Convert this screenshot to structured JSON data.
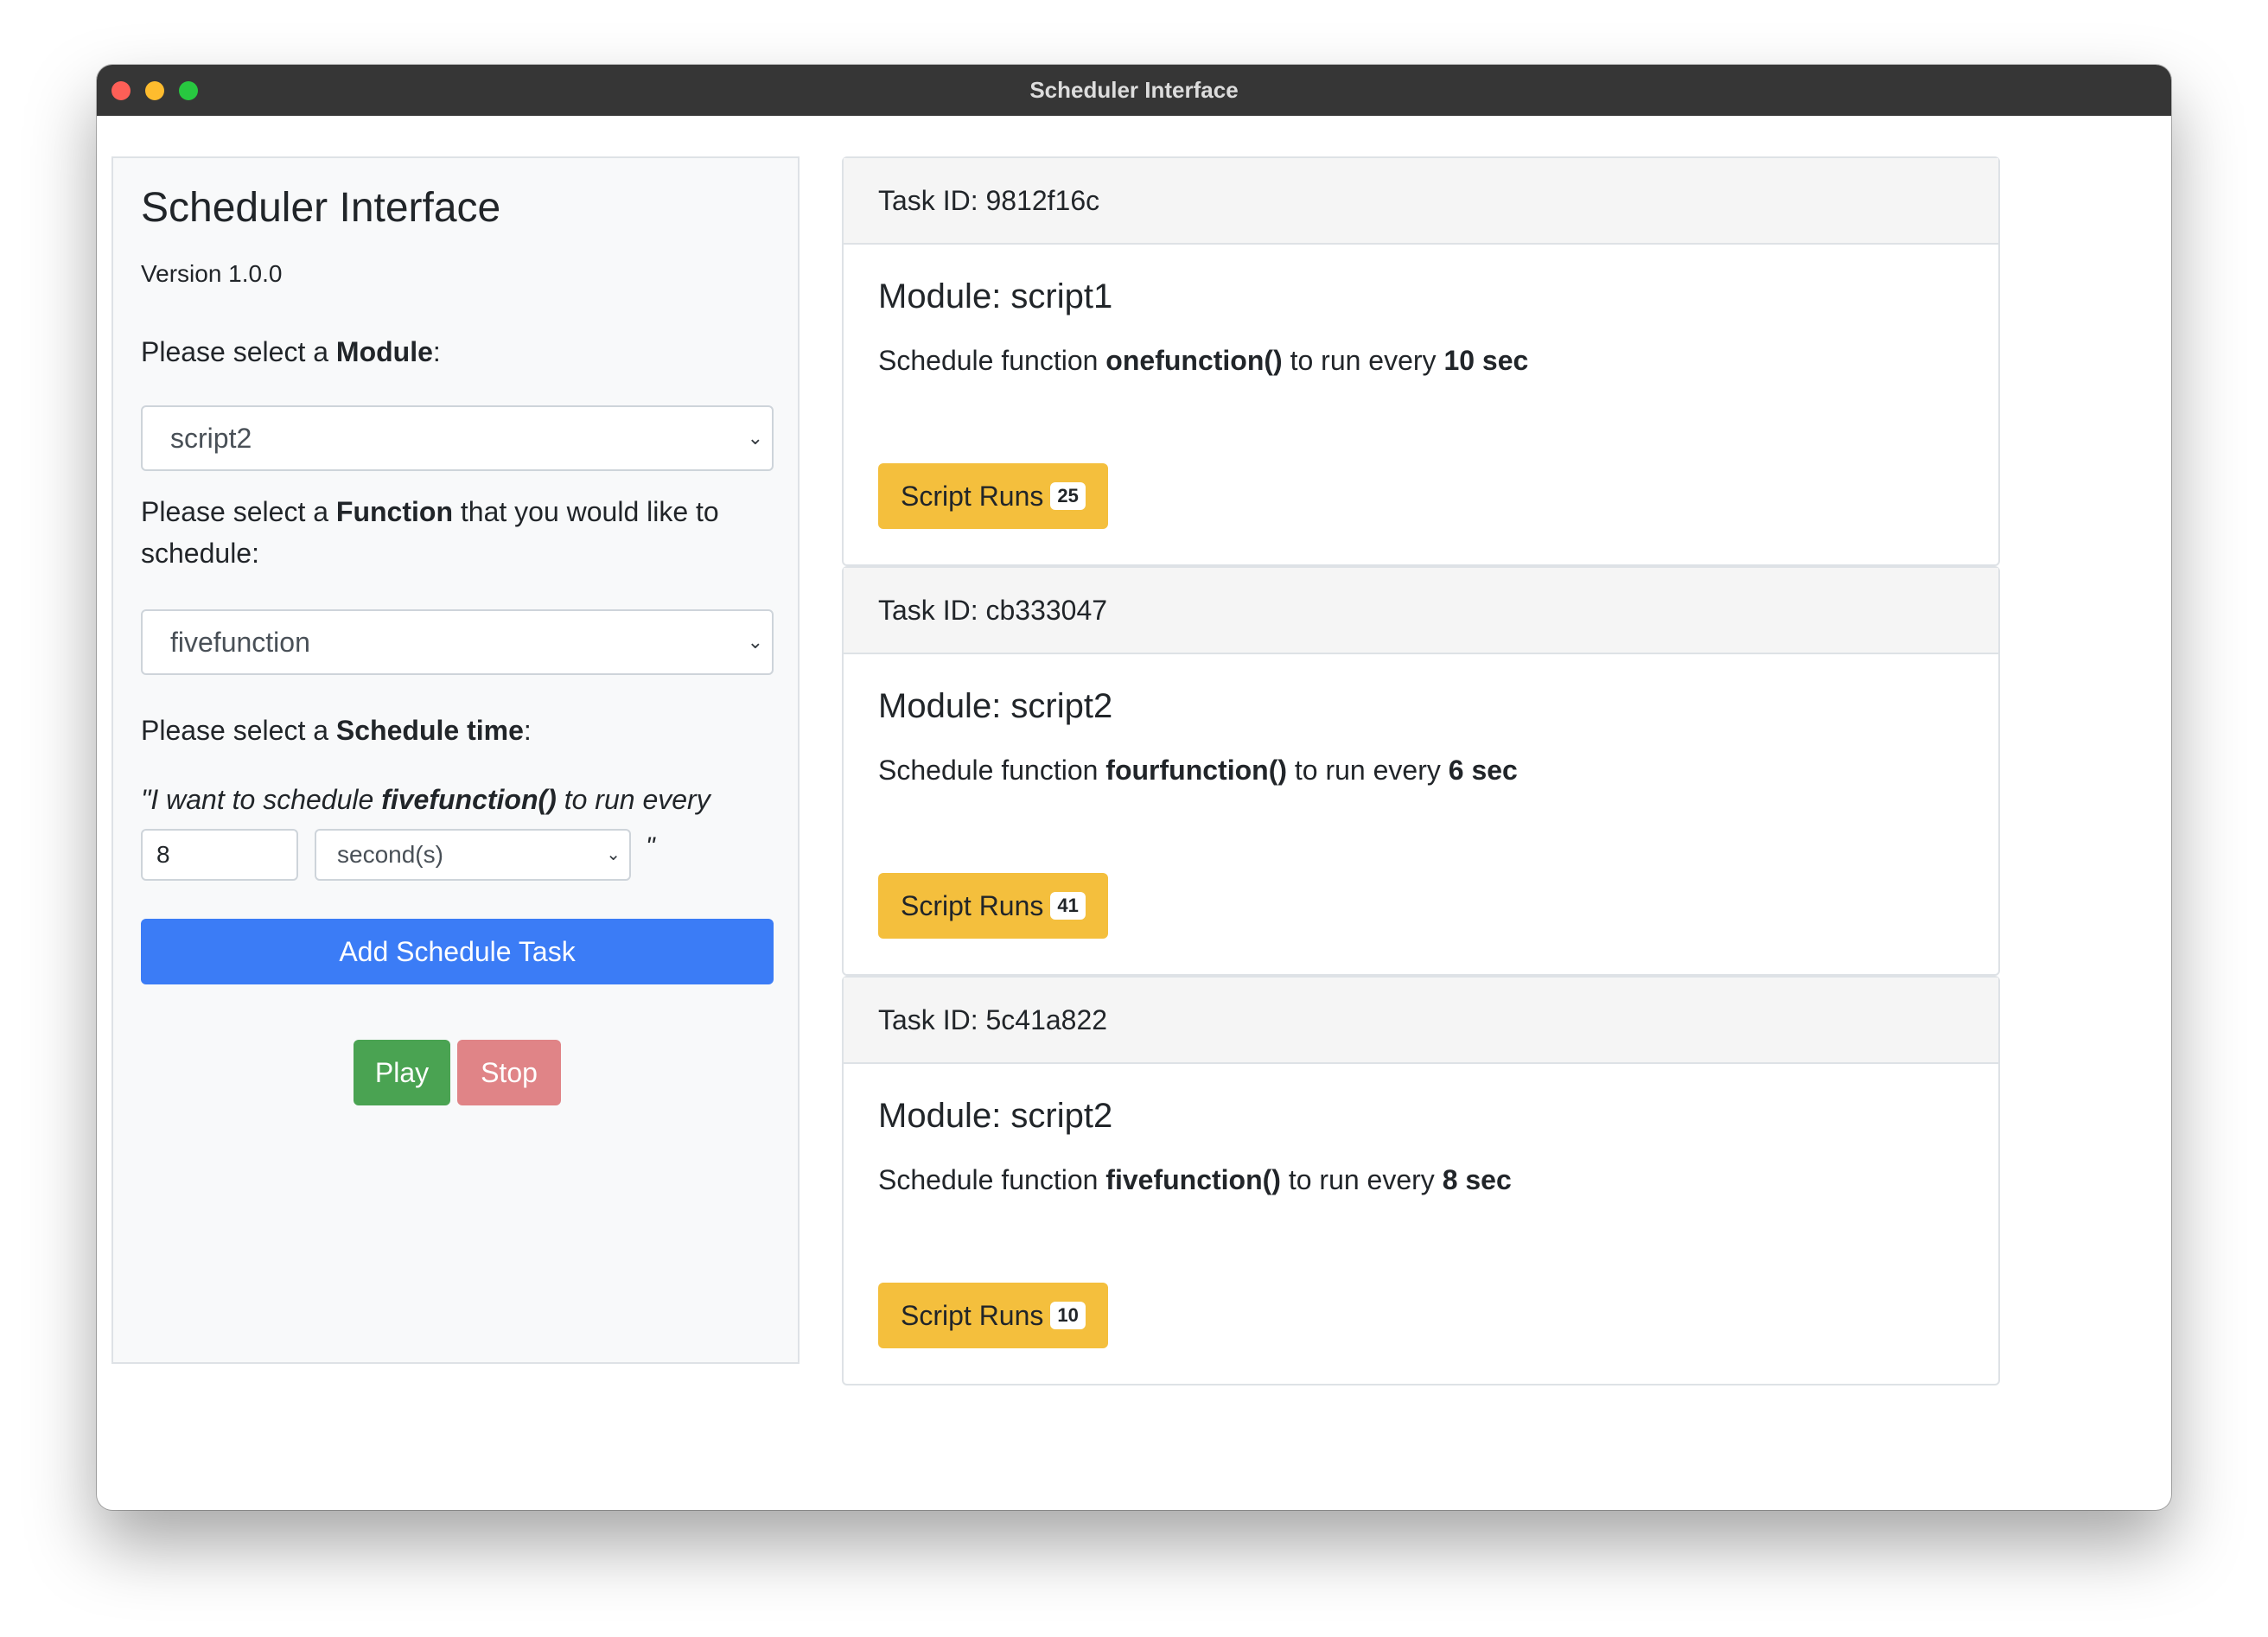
{
  "window": {
    "title": "Scheduler Interface"
  },
  "panel": {
    "title": "Scheduler Interface",
    "version": "Version 1.0.0",
    "module_label_prefix": "Please select a ",
    "module_label_bold": "Module",
    "module_label_suffix": ":",
    "module_value": "script2",
    "function_label_prefix": "Please select a ",
    "function_label_bold": "Function",
    "function_label_suffix": " that you would like to schedule:",
    "function_value": "fivefunction",
    "schedule_label_prefix": "Please select a ",
    "schedule_label_bold": "Schedule time",
    "schedule_label_suffix": ":",
    "sentence_prefix": "\"I want to schedule ",
    "sentence_function": "fivefunction()",
    "sentence_suffix": " to run every",
    "interval_value": "8",
    "unit_value": "second(s)",
    "close_quote": "\"",
    "add_button": "Add Schedule Task",
    "play_button": "Play",
    "stop_button": "Stop"
  },
  "tasks": [
    {
      "header": "Task ID: 9812f16c",
      "module": "Module: script1",
      "text_prefix": "Schedule function ",
      "function": "onefunction()",
      "text_mid": " to run every ",
      "interval": "10 sec",
      "runs_label": "Script Runs",
      "runs_count": "25"
    },
    {
      "header": "Task ID: cb333047",
      "module": "Module: script2",
      "text_prefix": "Schedule function ",
      "function": "fourfunction()",
      "text_mid": " to run every ",
      "interval": "6 sec",
      "runs_label": "Script Runs",
      "runs_count": "41"
    },
    {
      "header": "Task ID: 5c41a822",
      "module": "Module: script2",
      "text_prefix": "Schedule function ",
      "function": "fivefunction()",
      "text_mid": " to run every ",
      "interval": "8 sec",
      "runs_label": "Script Runs",
      "runs_count": "10"
    }
  ],
  "colors": {
    "primary": "#3b7cf6",
    "success": "#4aa352",
    "danger_disabled": "#e08487",
    "warning": "#f4bf3d",
    "titlebar": "#363636"
  }
}
